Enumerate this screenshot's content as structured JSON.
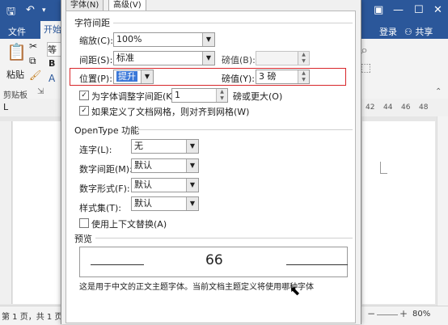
{
  "word": {
    "save_icon": "save-icon",
    "undo_icon": "undo-icon",
    "tabs": {
      "file": "文件",
      "home": "开始"
    },
    "login": "登录",
    "share": "共享",
    "paste": "粘贴",
    "clipboard": "剪贴板",
    "font_partial": "等",
    "bold": "B",
    "ruler_ticks": [
      "42",
      "44",
      "46",
      "48"
    ],
    "status_page": "第 1 页，共 1 页",
    "zoom": "80%",
    "zoom_minus": "−",
    "zoom_plus": "+"
  },
  "dialog": {
    "tabs": {
      "font": "字体(N)",
      "advanced": "高级(V)"
    },
    "char_spacing": {
      "section": "字符间距",
      "scale_label": "缩放(C):",
      "scale_value": "100%",
      "spacing_label": "间距(S):",
      "spacing_value": "标准",
      "spacing_pts_label": "磅值(B):",
      "spacing_pts_value": "",
      "position_label": "位置(P):",
      "position_value": "提升",
      "position_pts_label": "磅值(Y):",
      "position_pts_value": "3 磅",
      "kerning_label": "为字体调整字间距(K):",
      "kerning_value": "1",
      "kerning_suffix": "磅或更大(O)",
      "grid_label": "如果定义了文档网格，则对齐到网格(W)"
    },
    "opentype": {
      "section": "OpenType 功能",
      "ligature_label": "连字(L):",
      "ligature_value": "无",
      "num_spacing_label": "数字间距(M):",
      "num_spacing_value": "默认",
      "num_form_label": "数字形式(F):",
      "num_form_value": "默认",
      "stylistic_label": "样式集(T):",
      "stylistic_value": "默认",
      "contextual_label": "使用上下文替换(A)"
    },
    "preview": {
      "section": "预览",
      "sample": "66",
      "note": "这是用于中文的正文主题字体。当前文档主题定义将使用哪种字体"
    }
  }
}
